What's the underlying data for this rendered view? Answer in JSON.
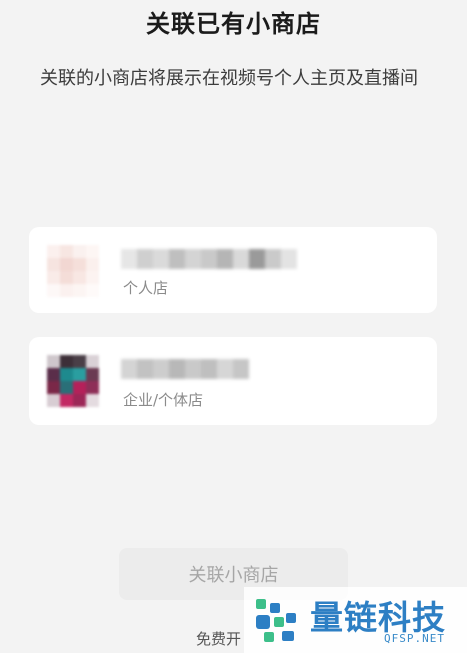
{
  "header": {
    "title": "关联已有小商店",
    "description": "关联的小商店将展示在视频号个人主页及直播间"
  },
  "shops": [
    {
      "type_label": "个人店",
      "avatar_colors": [
        "#fbf0ee",
        "#f7e6e2",
        "#faf1ef",
        "#fdf6f4",
        "#f6e4e0",
        "#f2d7d2",
        "#f5dfda",
        "#fbf0ed",
        "#f9ebe8",
        "#f4ddd8",
        "#f8e7e3",
        "#fcf3f1",
        "#fdf8f7",
        "#fbf1ef",
        "#fcf5f3",
        "#fefaf9"
      ],
      "name_colors": [
        "#e6e6e6",
        "#cfcfcf",
        "#dadada",
        "#bfbfbf",
        "#d4d4d4",
        "#c9c9c9",
        "#b5b5b5",
        "#d9d9d9",
        "#9a9a9a",
        "#cacaca",
        "#e3e3e3"
      ]
    },
    {
      "type_label": "企业/个体店",
      "avatar_colors": [
        "#cfc7cc",
        "#3d2f38",
        "#4a3f47",
        "#d9d1d6",
        "#5a2e4a",
        "#1e8a8e",
        "#2a9ea0",
        "#6b3a52",
        "#7a2848",
        "#2a6f78",
        "#b5215a",
        "#8e2f58",
        "#d8cdd3",
        "#c22863",
        "#9c2757",
        "#e4dbe0"
      ],
      "name_colors": [
        "#d4d4d4",
        "#c2c2c2",
        "#cdcdcd",
        "#b8b8b8",
        "#c9c9c9",
        "#bfbfbf",
        "#d6d6d6",
        "#c6c6c6"
      ]
    }
  ],
  "actions": {
    "link_button_label": "关联小商店",
    "open_store_label": "免费开"
  },
  "watermark": {
    "name": "量链科技",
    "domain": "QFSP.NET"
  },
  "colors": {
    "background": "#f3f3f3",
    "card": "#ffffff",
    "button_disabled_bg": "#ececec",
    "button_disabled_text": "#a6a6a6",
    "watermark_blue": "#2d7fc4",
    "watermark_green": "#3dbf8a"
  }
}
